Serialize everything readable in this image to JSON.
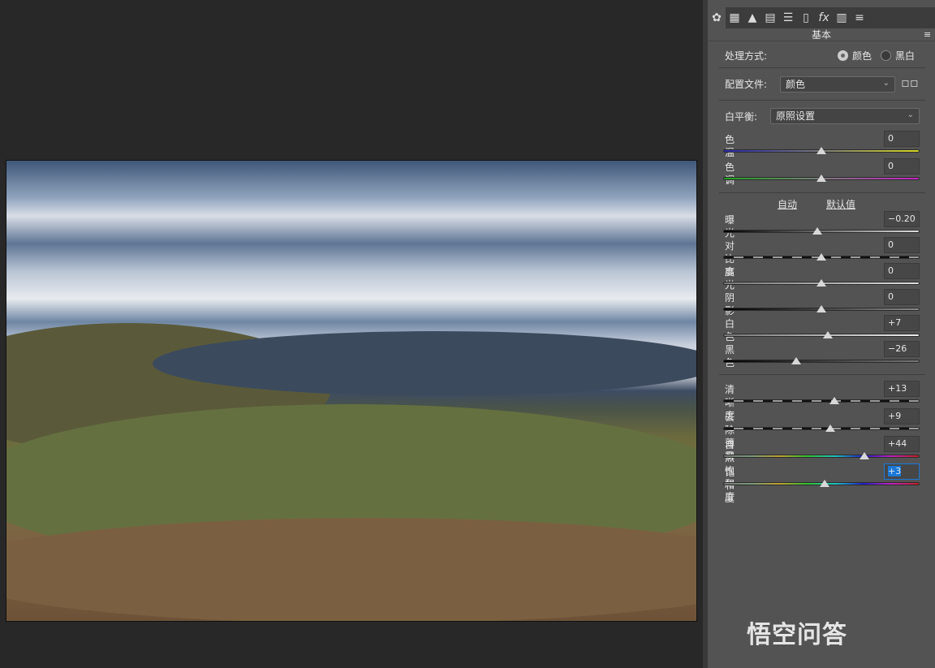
{
  "toolbar": {
    "icons": [
      "aperture-icon",
      "grid-curve-icon",
      "mountain-detail-icon",
      "hsl-icon",
      "split-toning-icon",
      "lens-icon",
      "fx-icon",
      "calibration-icon",
      "presets-icon"
    ],
    "fx_label": "fx"
  },
  "panel": {
    "title": "基本",
    "treatment": {
      "label": "处理方式:",
      "options": [
        "颜色",
        "黑白"
      ],
      "selected": "颜色"
    },
    "profile": {
      "label": "配置文件:",
      "value": "颜色"
    },
    "white_balance": {
      "label": "白平衡:",
      "value": "原照设置"
    },
    "auto_label": "自动",
    "default_label": "默认值",
    "sliders": [
      {
        "label": "色温",
        "value": "0",
        "num": 0,
        "min": -100,
        "max": 100
      },
      {
        "label": "色调",
        "value": "0",
        "num": 0,
        "min": -100,
        "max": 100
      },
      {
        "label": "曝光",
        "value": "−0.20",
        "num": -0.2,
        "min": -5,
        "max": 5
      },
      {
        "label": "对比度",
        "value": "0",
        "num": 0,
        "min": -100,
        "max": 100
      },
      {
        "label": "高光",
        "value": "0",
        "num": 0,
        "min": -100,
        "max": 100
      },
      {
        "label": "阴影",
        "value": "0",
        "num": 0,
        "min": -100,
        "max": 100
      },
      {
        "label": "白色",
        "value": "+7",
        "num": 7,
        "min": -100,
        "max": 100
      },
      {
        "label": "黑色",
        "value": "−26",
        "num": -26,
        "min": -100,
        "max": 100
      },
      {
        "label": "清晰度",
        "value": "+13",
        "num": 13,
        "min": -100,
        "max": 100
      },
      {
        "label": "去除薄雾",
        "value": "+9",
        "num": 9,
        "min": -100,
        "max": 100
      },
      {
        "label": "自然饱和度",
        "value": "+44",
        "num": 44,
        "min": -100,
        "max": 100
      },
      {
        "label": "饱和度",
        "value": "+3",
        "num": 3,
        "min": -100,
        "max": 100
      }
    ]
  },
  "watermark": "悟空问答"
}
